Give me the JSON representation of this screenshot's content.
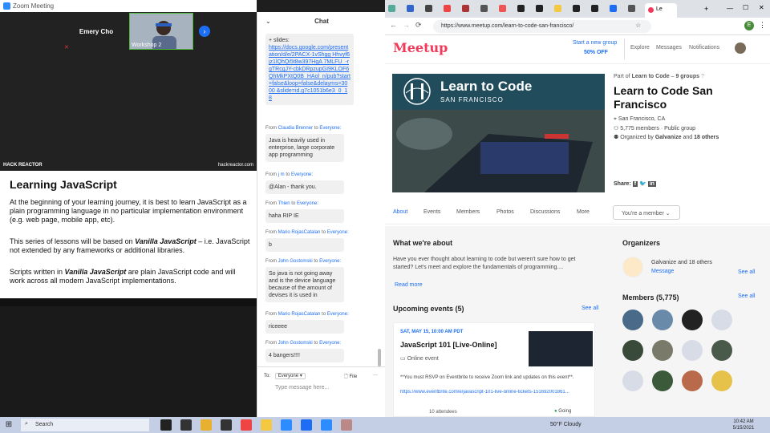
{
  "zoom": {
    "title": "Zoom Meeting",
    "participant_name": "Emery Cho",
    "webcam_label": "Workshop 2",
    "slide": {
      "brand_left": "HACK REACTOR",
      "brand_right": "hackreactor.com",
      "title": "Learning JavaScript",
      "p1": "At the beginning of your learning journey, it is best to learn JavaScript as a plain programming language in no particular implementation environment (e.g. web page, mobile app, etc).",
      "p2_a": "This series of lessons will be based on ",
      "p2_em": "Vanilla JavaScript",
      "p2_b": " – i.e. JavaScript not extended by any frameworks or additional libraries.",
      "p3_a": "Scripts written in ",
      "p3_em": "Vanilla JavaScript",
      "p3_b": " are plain JavaScript code and will work across all modern JavaScript implementations."
    }
  },
  "chat": {
    "title": "Chat",
    "first_msg_prefix": "+ slides:",
    "first_msg_link": "https://docs.google.com/presentation/d/e/2PACX-1vShgg Hhvyf6jz1lQhQi5t8w397HgA 7MLFU_-rgTRcgJY-cbkDRpzupGI9KLOF6QhMkPXtQ0B_HAol_n/pub?start=false&loop=false&delayms=3000 &slide=id.g7c1051b6e3_0_18",
    "messages": [
      {
        "from": "Claudia Brenner",
        "to": "Everyone:",
        "text": "Java is heavily used in enterprise, large corporate app programming"
      },
      {
        "from": "j m",
        "to": "Everyone:",
        "text": "@Alan - thank you."
      },
      {
        "from": "Thien",
        "to": "Everyone:",
        "text": "haha RIP IE"
      },
      {
        "from": "Mario RojasCatalan",
        "to": "Everyone:",
        "text": "b"
      },
      {
        "from": "John Gostomski",
        "to": "Everyone:",
        "text": "So java is not going away and is the device language because of the amount of devises it is used in"
      },
      {
        "from": "Mario RojasCatalan",
        "to": "Everyone:",
        "text": "riceeee"
      },
      {
        "from": "John Gostomski",
        "to": "Everyone:",
        "text": "4 bangers!!!!"
      }
    ],
    "from_word": "From",
    "to_word": "to",
    "to_label": "To:",
    "recipient": "Everyone",
    "file_label": "File",
    "placeholder": "Type message here..."
  },
  "browser": {
    "url": "https://www.meetup.com/learn-to-code-san-francisco/",
    "tab_active_label": "Le"
  },
  "meetup": {
    "logo": "Meetup",
    "start_group": "Start a new group",
    "discount": "50% OFF",
    "nav_explore": "Explore",
    "nav_messages": "Messages",
    "nav_notifications": "Notifications",
    "hero_title": "Learn to Code",
    "hero_sub": "SAN FRANCISCO",
    "part_of_prefix": "Part of",
    "part_of_name": "Learn to Code",
    "part_of_groups": "9 groups",
    "group_title": "Learn to Code San Francisco",
    "location": "San Francisco, CA",
    "members_line": "5,775 members · Public group",
    "organized_prefix": "Organized by",
    "organized_name": "Galvanize",
    "organized_others": "18 others",
    "share": "Share:",
    "tabs": [
      "About",
      "Events",
      "Members",
      "Photos",
      "Discussions",
      "More"
    ],
    "member_btn": "You're a member",
    "about_title": "What we're about",
    "about_text": "Have you ever thought about learning to code but weren't sure how to get started? Let's meet and explore the fundamentals of programming....",
    "read_more": "Read more",
    "organizers_title": "Organizers",
    "organizer_name": "Galvanize",
    "organizer_others": "and 18 others",
    "message": "Message",
    "see_all": "See all",
    "upcoming_title": "Upcoming events (5)",
    "event_date": "SAT, MAY 15, 10:00 AM PDT",
    "event_title": "JavaScript 101 [Live-Online]",
    "event_type": "Online event",
    "event_desc": "**You must RSVP on Eventbrite to receive Zoom link and updates on this event**.",
    "event_link": "https://www.eventbrite.com/e/javascript-101-live-online-tickets-151692001861...",
    "attendees": "10 attendees",
    "going": "Going",
    "members_title": "Members (5,775)"
  },
  "taskbar": {
    "search": "Search",
    "weather": "50°F  Cloudy",
    "time": "10:42 AM",
    "date": "5/15/2021"
  },
  "colors": {
    "meetup_red": "#f13a59",
    "zoom_blue": "#2d8cff",
    "link_blue": "#1d6ef5",
    "hero_teal": "#214c5c"
  }
}
